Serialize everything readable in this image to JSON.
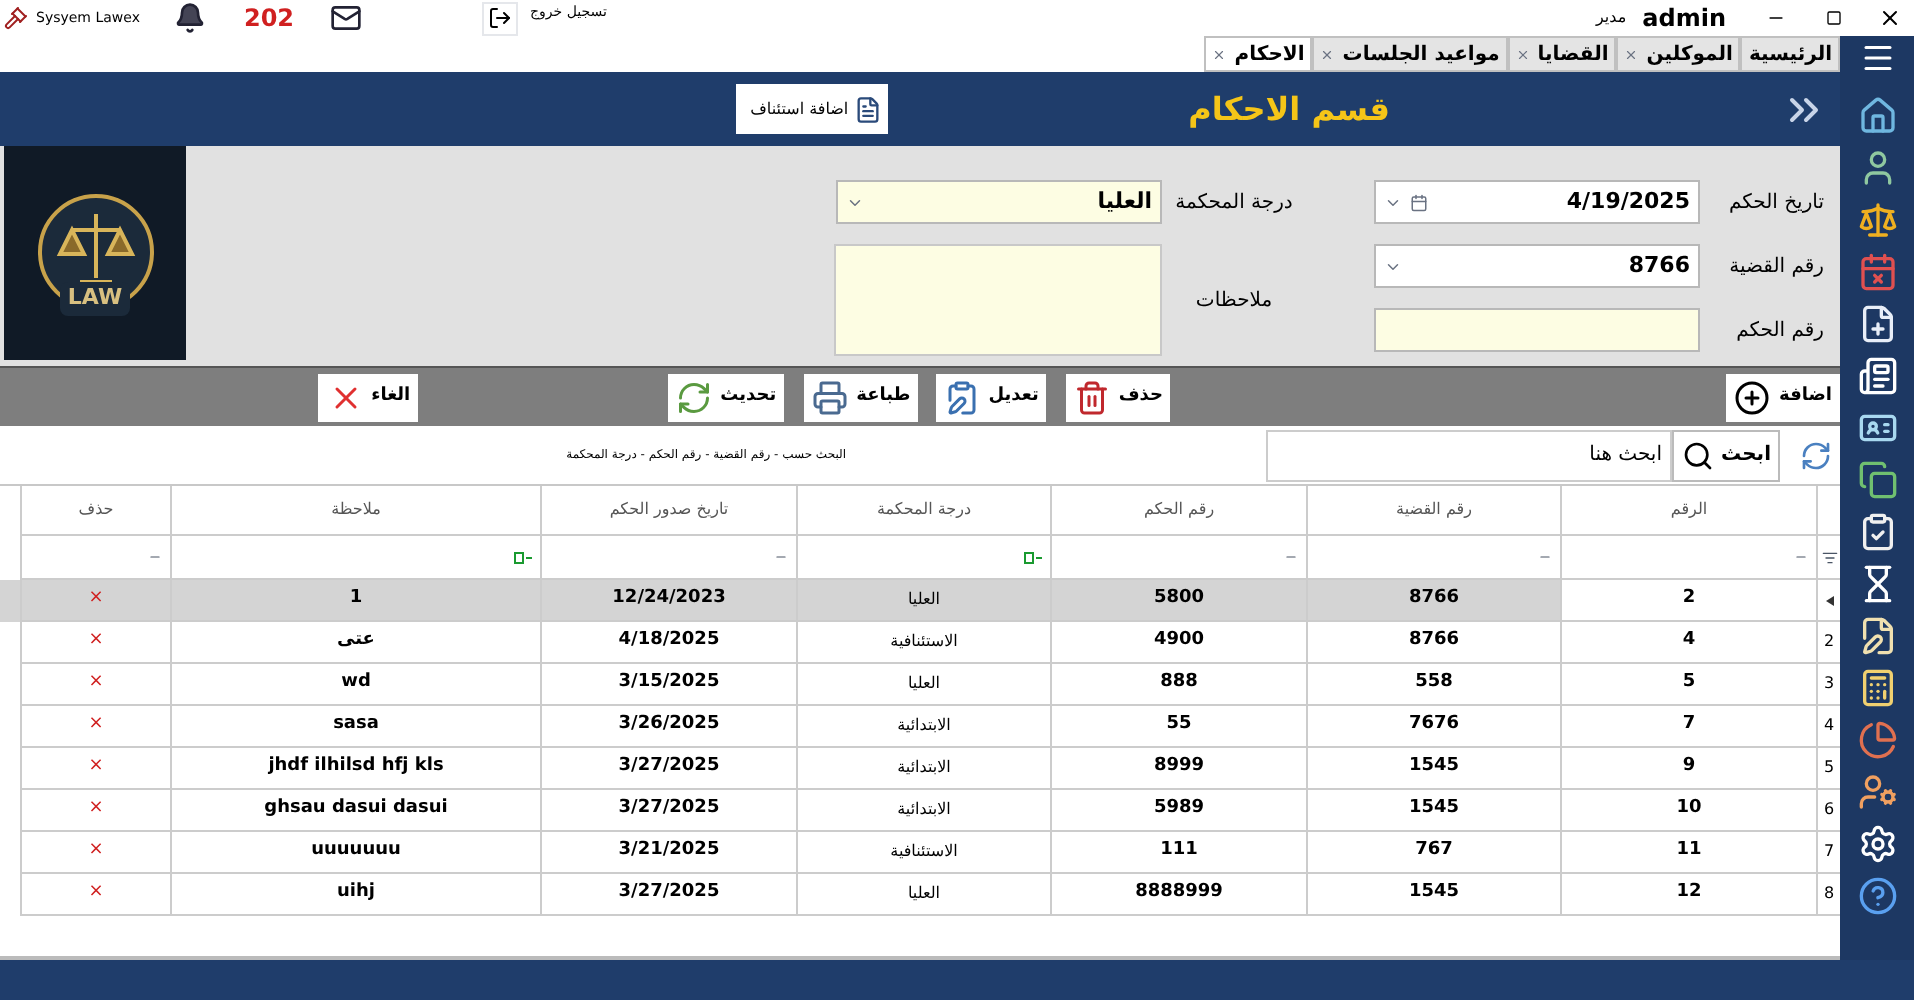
{
  "app": {
    "name": "Sysyem Lawex",
    "notification_count": "202",
    "logout_label": "تسجيل خروج",
    "user_name": "admin",
    "user_role": "مدير"
  },
  "tabs": [
    {
      "label": "الرئيسية",
      "closable": false,
      "selected": false
    },
    {
      "label": "الموكلين",
      "closable": true,
      "selected": false
    },
    {
      "label": "القضايا",
      "closable": true,
      "selected": false
    },
    {
      "label": "مواعيد الجلسات",
      "closable": true,
      "selected": false
    },
    {
      "label": "الاحكام",
      "closable": true,
      "selected": true
    }
  ],
  "header": {
    "title": "قسم الاحكام",
    "appeal_button": "اضافة استئناف"
  },
  "logo": {
    "text": "LAW"
  },
  "form": {
    "right_fields": [
      {
        "label": "تاريخ الحكم",
        "value": "4/19/2025",
        "kind": "date",
        "highlighted": false
      },
      {
        "label": "رقم القضية",
        "value": "8766",
        "kind": "combo",
        "highlighted": false
      },
      {
        "label": "رقم الحكم",
        "kind": "text",
        "highlighted": true
      }
    ],
    "left_fields": [
      {
        "label": "درجة المحكمة",
        "value": "العليا",
        "kind": "combo",
        "highlighted": true
      },
      {
        "label": "ملاحظات",
        "kind": "textarea",
        "highlighted": true
      }
    ]
  },
  "toolbar": [
    {
      "label": "اضافة",
      "kind": "add"
    },
    {
      "label": "حذف",
      "kind": "delete"
    },
    {
      "label": "تعديل",
      "kind": "edit"
    },
    {
      "label": "طباعة",
      "kind": "print"
    },
    {
      "label": "تحديث",
      "kind": "refresh"
    },
    {
      "label": "الغاء",
      "kind": "cancel"
    }
  ],
  "search": {
    "button": "ابحث",
    "placeholder": "ابحث هنا",
    "hint": "البحث حسب - رقم القضية - رقم الحكم - درجة المحكمة"
  },
  "table": {
    "columns": [
      {
        "label": "الرقم",
        "kind": "default"
      },
      {
        "label": "رقم القضية",
        "kind": "default"
      },
      {
        "label": "رقم الحكم",
        "kind": "default"
      },
      {
        "label": "درجة المحكمة",
        "kind": "text"
      },
      {
        "label": "تاريخ صدور الحكم",
        "kind": "default"
      },
      {
        "label": "ملاحظة",
        "kind": "text"
      },
      {
        "label": "حذف",
        "kind": "default"
      }
    ],
    "rows": [
      {
        "current": true,
        "selected": true,
        "cells": [
          "2",
          "8766",
          "5800",
          "العليا",
          "12/24/2023",
          "1"
        ],
        "delete": "×"
      },
      {
        "row_header": "2",
        "current": false,
        "selected": false,
        "cells": [
          "4",
          "8766",
          "4900",
          "الاستئنافية",
          "4/18/2025",
          "عتى"
        ],
        "delete": "×"
      },
      {
        "row_header": "3",
        "current": false,
        "selected": false,
        "cells": [
          "5",
          "558",
          "888",
          "العليا",
          "3/15/2025",
          "wd"
        ],
        "delete": "×"
      },
      {
        "row_header": "4",
        "current": false,
        "selected": false,
        "cells": [
          "7",
          "7676",
          "55",
          "الابتدائية",
          "3/26/2025",
          "sasa"
        ],
        "delete": "×"
      },
      {
        "row_header": "5",
        "current": false,
        "selected": false,
        "cells": [
          "9",
          "1545",
          "8999",
          "الابتدائية",
          "3/27/2025",
          "jhdf ilhilsd hfj kls"
        ],
        "delete": "×"
      },
      {
        "row_header": "6",
        "current": false,
        "selected": false,
        "cells": [
          "10",
          "1545",
          "5989",
          "الابتدائية",
          "3/27/2025",
          "ghsau dasui dasui"
        ],
        "delete": "×"
      },
      {
        "row_header": "7",
        "current": false,
        "selected": false,
        "cells": [
          "11",
          "767",
          "111",
          "الاستئنافية",
          "3/21/2025",
          "uuuuuuu"
        ],
        "delete": "×"
      },
      {
        "row_header": "8",
        "current": false,
        "selected": false,
        "cells": [
          "12",
          "1545",
          "8888999",
          "العليا",
          "3/27/2025",
          "uihj"
        ],
        "delete": "×"
      }
    ]
  }
}
